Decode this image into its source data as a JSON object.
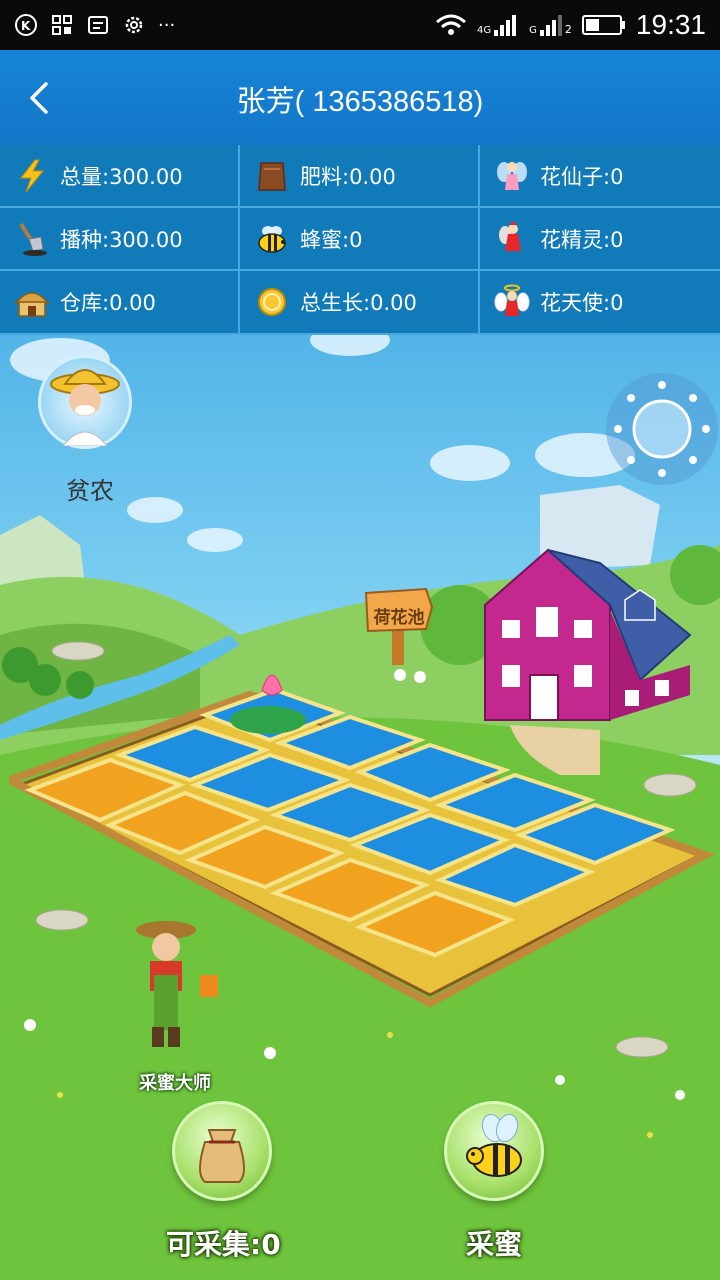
{
  "status_bar": {
    "time": "19:31",
    "network_4g": "4G",
    "network_g": "G",
    "sim2": "2"
  },
  "header": {
    "title": "张芳( 1365386518)"
  },
  "stats": [
    {
      "icon": "lightning-icon",
      "label": "总量:300.00"
    },
    {
      "icon": "fertilizer-bag-icon",
      "label": "肥料:0.00"
    },
    {
      "icon": "fairy-icon",
      "label": "花仙子:0"
    },
    {
      "icon": "shovel-seed-icon",
      "label": "播种:300.00"
    },
    {
      "icon": "bee-icon",
      "label": "蜂蜜:0"
    },
    {
      "icon": "sprite-icon",
      "label": "花精灵:0"
    },
    {
      "icon": "hut-icon",
      "label": "仓库:0.00"
    },
    {
      "icon": "coin-icon",
      "label": "总生长:0.00"
    },
    {
      "icon": "angel-icon",
      "label": "花天使:0"
    }
  ],
  "scene": {
    "avatar_label": "贫农",
    "sign_label": "荷花池",
    "farmer_label": "采蜜大师",
    "collect_label": "可采集:0",
    "honey_label": "采蜜"
  }
}
